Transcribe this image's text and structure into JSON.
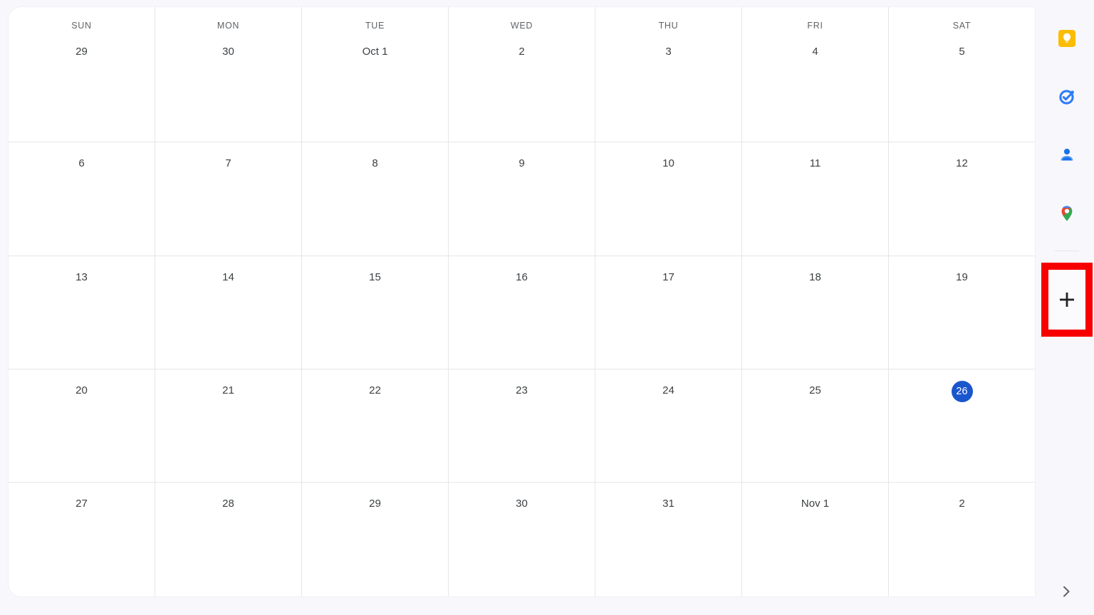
{
  "calendar": {
    "day_headers": [
      "SUN",
      "MON",
      "TUE",
      "WED",
      "THU",
      "FRI",
      "SAT"
    ],
    "today_label": "26",
    "today_color": "#1a56cc",
    "weeks": [
      {
        "days": [
          {
            "label": "29",
            "today": false
          },
          {
            "label": "30",
            "today": false
          },
          {
            "label": "Oct 1",
            "today": false
          },
          {
            "label": "2",
            "today": false
          },
          {
            "label": "3",
            "today": false
          },
          {
            "label": "4",
            "today": false
          },
          {
            "label": "5",
            "today": false
          }
        ]
      },
      {
        "days": [
          {
            "label": "6",
            "today": false
          },
          {
            "label": "7",
            "today": false
          },
          {
            "label": "8",
            "today": false
          },
          {
            "label": "9",
            "today": false
          },
          {
            "label": "10",
            "today": false
          },
          {
            "label": "11",
            "today": false
          },
          {
            "label": "12",
            "today": false
          }
        ]
      },
      {
        "days": [
          {
            "label": "13",
            "today": false
          },
          {
            "label": "14",
            "today": false
          },
          {
            "label": "15",
            "today": false
          },
          {
            "label": "16",
            "today": false
          },
          {
            "label": "17",
            "today": false
          },
          {
            "label": "18",
            "today": false
          },
          {
            "label": "19",
            "today": false
          }
        ]
      },
      {
        "days": [
          {
            "label": "20",
            "today": false
          },
          {
            "label": "21",
            "today": false
          },
          {
            "label": "22",
            "today": false
          },
          {
            "label": "23",
            "today": false
          },
          {
            "label": "24",
            "today": false
          },
          {
            "label": "25",
            "today": false
          },
          {
            "label": "26",
            "today": true
          }
        ]
      },
      {
        "days": [
          {
            "label": "27",
            "today": false
          },
          {
            "label": "28",
            "today": false
          },
          {
            "label": "29",
            "today": false
          },
          {
            "label": "30",
            "today": false
          },
          {
            "label": "31",
            "today": false
          },
          {
            "label": "Nov 1",
            "today": false
          },
          {
            "label": "2",
            "today": false
          }
        ]
      }
    ]
  },
  "side_panel": {
    "icons": [
      {
        "name": "google-keep-icon",
        "title": "Keep"
      },
      {
        "name": "google-tasks-icon",
        "title": "Tasks"
      },
      {
        "name": "google-contacts-icon",
        "title": "Contacts"
      },
      {
        "name": "google-maps-icon",
        "title": "Maps"
      }
    ],
    "add_button": {
      "name": "add-apps-plus-icon",
      "title": "Get add-ons"
    },
    "expand_chevron": {
      "name": "chevron-right-icon",
      "title": "Show side panel"
    },
    "highlight_color": "#f80000"
  }
}
